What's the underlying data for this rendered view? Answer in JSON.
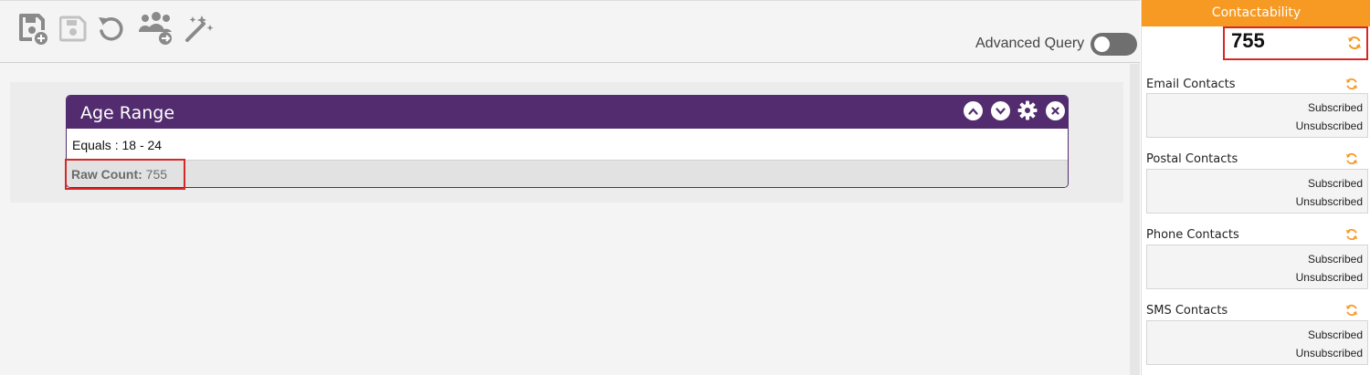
{
  "toolbar": {
    "icons": [
      "save-new-icon",
      "save-icon",
      "undo-icon",
      "group-transfer-icon",
      "magic-wand-icon"
    ],
    "advanced_query_label": "Advanced Query",
    "advanced_query_on": false
  },
  "criteria_card": {
    "title": "Age Range",
    "rule": "Equals : 18 - 24",
    "raw_count_label": "Raw Count:",
    "raw_count_value": "755"
  },
  "contactability": {
    "header": "Contactability",
    "total": "755",
    "sections": [
      {
        "title": "Email Contacts",
        "subscribed": "Subscribed",
        "unsubscribed": "Unsubscribed"
      },
      {
        "title": "Postal Contacts",
        "subscribed": "Subscribed",
        "unsubscribed": "Unsubscribed"
      },
      {
        "title": "Phone Contacts",
        "subscribed": "Subscribed",
        "unsubscribed": "Unsubscribed"
      },
      {
        "title": "SMS Contacts",
        "subscribed": "Subscribed",
        "unsubscribed": "Unsubscribed"
      }
    ]
  },
  "colors": {
    "purple": "#522c6e",
    "orange": "#f79a24",
    "highlight_red": "#d62828"
  }
}
